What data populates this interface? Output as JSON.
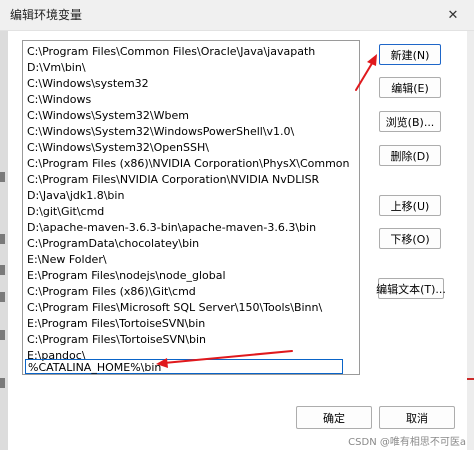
{
  "window": {
    "title": "编辑环境变量",
    "close_glyph": "✕"
  },
  "paths": [
    "C:\\Program Files\\Common Files\\Oracle\\Java\\javapath",
    "D:\\Vm\\bin\\",
    "C:\\Windows\\system32",
    "C:\\Windows",
    "C:\\Windows\\System32\\Wbem",
    "C:\\Windows\\System32\\WindowsPowerShell\\v1.0\\",
    "C:\\Windows\\System32\\OpenSSH\\",
    "C:\\Program Files (x86)\\NVIDIA Corporation\\PhysX\\Common",
    "C:\\Program Files\\NVIDIA Corporation\\NVIDIA NvDLISR",
    "D:\\Java\\jdk1.8\\bin",
    "D:\\git\\Git\\cmd",
    "D:\\apache-maven-3.6.3-bin\\apache-maven-3.6.3\\bin",
    "C:\\ProgramData\\chocolatey\\bin",
    "E:\\New Folder\\",
    "E:\\Program Files\\nodejs\\node_global",
    "C:\\Program Files (x86)\\Git\\cmd",
    "C:\\Program Files\\Microsoft SQL Server\\150\\Tools\\Binn\\",
    "E:\\Program Files\\TortoiseSVN\\bin",
    "C:\\Program Files\\TortoiseSVN\\bin",
    "E:\\pandoc\\",
    "%CATALINA_HOME%\\bin"
  ],
  "buttons": {
    "new": "新建(N)",
    "edit": "编辑(E)",
    "browse": "浏览(B)...",
    "delete": "删除(D)",
    "move_up": "上移(U)",
    "move_down": "下移(O)",
    "edit_text": "编辑文本(T)...",
    "ok": "确定",
    "cancel": "取消"
  },
  "watermark": "CSDN @唯有相思不可医a",
  "colors": {
    "annotation_arrow": "#e0191d",
    "focus_border": "#0a64c8"
  }
}
